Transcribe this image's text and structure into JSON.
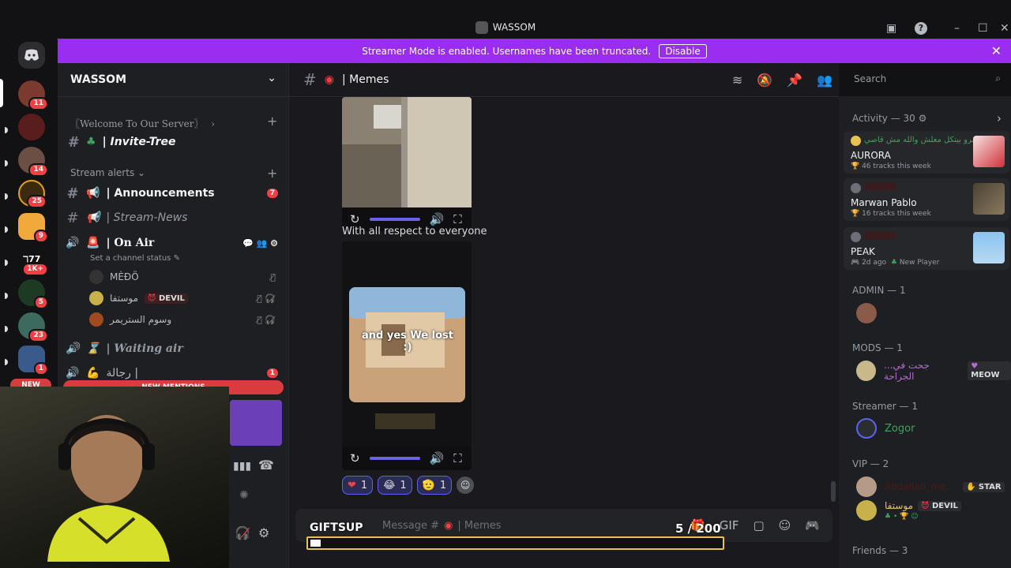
{
  "window": {
    "title": "WASSOM"
  },
  "banner": {
    "text": "Streamer Mode is enabled. Usernames have been truncated.",
    "button": "Disable"
  },
  "rail": {
    "servers": [
      {
        "badge": "11"
      },
      {
        "badge": ""
      },
      {
        "badge": "14"
      },
      {
        "badge": "25"
      },
      {
        "badge": "9"
      },
      {
        "badge": "1K+"
      },
      {
        "badge": "5"
      },
      {
        "badge": "23"
      },
      {
        "badge": "1"
      }
    ],
    "new_label": "NEW"
  },
  "sidebar": {
    "server_name": "WASSOM",
    "welcome_category": "〖Welcome To Our Server〗",
    "invite_channel": "| Invite-Tree",
    "stream_alerts": "Stream alerts",
    "announcements": "| Announcements",
    "announcements_badge": "7",
    "stream_news": "| Stream-News",
    "on_air": "| On Air",
    "set_status": "Set a channel status",
    "voice_users": [
      "MÈÐÖ",
      "موستفا",
      "وسوم الستريمر"
    ],
    "devil_tag": "DEVIL",
    "waiting_air": "| Waiting air",
    "rjala": "رجالة |",
    "rjala_badge": "1",
    "new_mentions": "NEW MENTIONS"
  },
  "main": {
    "channel": "| Memes",
    "message_text": "With all respect to everyone",
    "reactions": [
      {
        "emoji": "❤",
        "count": "1"
      },
      {
        "emoji": "😂",
        "count": "1"
      },
      {
        "emoji": "🫡",
        "count": "1"
      }
    ],
    "composer_placeholder": "Message #",
    "composer_channel": "| Memes",
    "video_caption": "and yes We lost :)"
  },
  "search": {
    "placeholder": "Search"
  },
  "overlay": {
    "gifts_label": "GIFTSUP",
    "count_text": "5 / 200",
    "progress": 0.025
  },
  "right": {
    "activity_header": "Activity — 30",
    "cards": [
      {
        "title": "عمرو بيتكل معلش والله مش قاصي",
        "name": "AURORA",
        "sub": "46 tracks this week"
      },
      {
        "title": "",
        "name": "Marwan Pablo",
        "sub": "16 tracks this week"
      },
      {
        "title": "",
        "name": "PEAK",
        "sub": "2d ago",
        "sub2": "New Player"
      }
    ],
    "admin_header": "ADMIN — 1",
    "mods_header": "MODS — 1",
    "mods_user": "...جحت في الجراحة",
    "mods_tag": "MEOW",
    "streamer_header": "Streamer — 1",
    "streamer_user": "Zogor",
    "vip_header": "VIP — 2",
    "vip_user1": "Abdallah_me...",
    "vip_tag1": "STAR",
    "vip_user2": "موستفا",
    "vip_tag2": "DEVIL",
    "friends_header": "Friends — 3"
  },
  "colors": {
    "brand": "#9b2df0",
    "accent": "#5865f2",
    "badge": "#f23f43",
    "streamer_green": "#3ba55c"
  }
}
